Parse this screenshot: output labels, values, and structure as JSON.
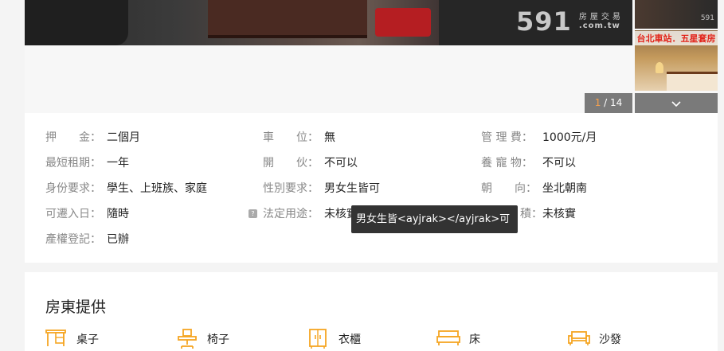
{
  "gallery": {
    "watermark_number": "591",
    "watermark_top": "房屋交易",
    "watermark_bottom": ".com.tw",
    "thumb1_watermark": "591",
    "thumb2_caption": "台北車站．五星套房",
    "pager_current": "1",
    "pager_separator": " / ",
    "pager_total": "14",
    "more_icon": "chevron-down-icon"
  },
  "details": {
    "rows": [
      [
        {
          "label": "押　　金：",
          "value": "二個月"
        },
        {
          "label": "車　　位：",
          "value": "無"
        },
        {
          "label": "管 理 費：",
          "value": "1000元/月"
        }
      ],
      [
        {
          "label": "最短租期：",
          "value": "一年"
        },
        {
          "label": "開　　伙：",
          "value": "不可以"
        },
        {
          "label": "養 寵 物：",
          "value": "不可以"
        }
      ],
      [
        {
          "label": "身份要求：",
          "value": "學生、上班族、家庭"
        },
        {
          "label": "性別要求：",
          "value": "男女生皆可"
        },
        {
          "label": "朝　　向：",
          "value": "坐北朝南"
        }
      ],
      [
        {
          "label": "可遷入日：",
          "value": "隨時"
        },
        {
          "label": "法定用途：",
          "value": "未核實"
        },
        {
          "label": "積：",
          "value": "未核實"
        }
      ],
      [
        {
          "label": "產權登記：",
          "value": "已辦"
        }
      ]
    ],
    "help_icon_glyph": "?"
  },
  "tooltip": {
    "text": "男女生皆<ayjrak></ayjrak>可"
  },
  "provide": {
    "title": "房東提供",
    "items": [
      {
        "icon": "desk-icon",
        "label": "桌子"
      },
      {
        "icon": "chair-icon",
        "label": "椅子"
      },
      {
        "icon": "wardrobe-icon",
        "label": "衣櫃"
      },
      {
        "icon": "bed-icon",
        "label": "床"
      },
      {
        "icon": "sofa-icon",
        "label": "沙發"
      }
    ],
    "icon_color": "#f5a623"
  }
}
